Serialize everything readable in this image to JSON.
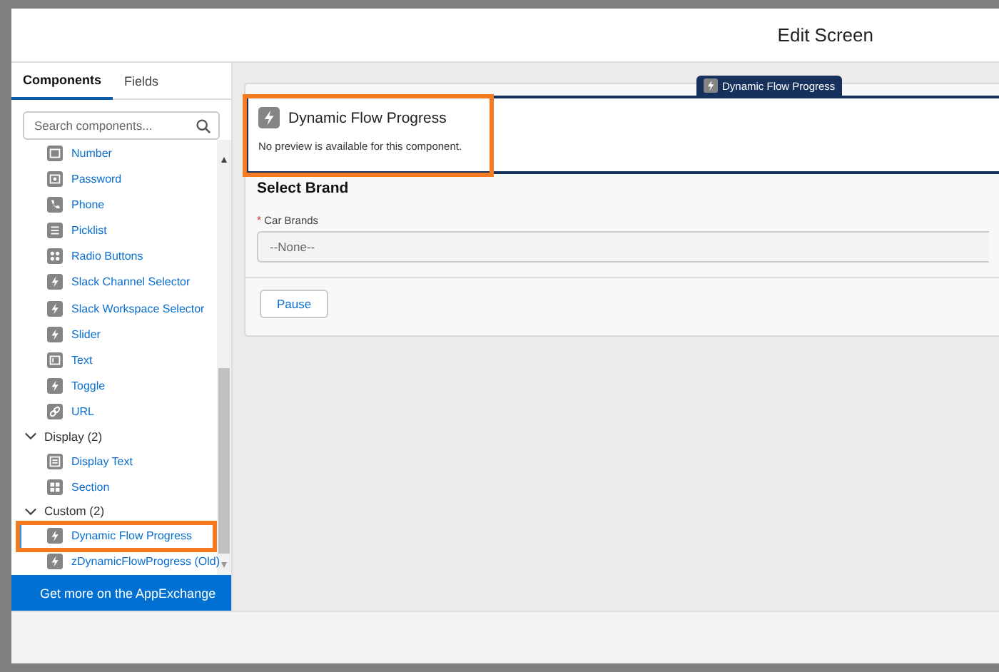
{
  "window": {
    "title": "Edit Screen"
  },
  "sidebar": {
    "tabs": [
      {
        "label": "Components",
        "selected": true
      },
      {
        "label": "Fields",
        "selected": false
      }
    ],
    "search": {
      "placeholder": "Search components..."
    },
    "items": [
      {
        "kind": "number",
        "label": "Number",
        "selected": false,
        "highlighted": false
      },
      {
        "kind": "password",
        "label": "Password",
        "selected": false,
        "highlighted": false
      },
      {
        "kind": "phone",
        "label": "Phone",
        "selected": false,
        "highlighted": false
      },
      {
        "kind": "picklist",
        "label": "Picklist",
        "selected": false,
        "highlighted": false
      },
      {
        "kind": "radio",
        "label": "Radio Buttons",
        "selected": false,
        "highlighted": false
      },
      {
        "kind": "lightning",
        "label": "Slack Channel Selector",
        "selected": false,
        "highlighted": false
      },
      {
        "kind": "lightning",
        "label": "Slack Workspace Selector",
        "selected": false,
        "highlighted": false
      },
      {
        "kind": "lightning",
        "label": "Slider",
        "selected": false,
        "highlighted": false
      },
      {
        "kind": "text",
        "label": "Text",
        "selected": false,
        "highlighted": false
      },
      {
        "kind": "lightning",
        "label": "Toggle",
        "selected": false,
        "highlighted": false
      },
      {
        "kind": "link",
        "label": "URL",
        "selected": false,
        "highlighted": false
      },
      {
        "kind": "group",
        "label": "Display (2)",
        "expanded": true,
        "children": [
          {
            "kind": "display_text",
            "label": "Display Text",
            "selected": false,
            "highlighted": false
          },
          {
            "kind": "section",
            "label": "Section",
            "selected": false,
            "highlighted": false
          }
        ]
      },
      {
        "kind": "group",
        "label": "Custom (2)",
        "expanded": true,
        "children": [
          {
            "kind": "lightning",
            "label": "Dynamic Flow Progress",
            "selected": true,
            "highlighted": true
          },
          {
            "kind": "lightning",
            "label": "zDynamicFlowProgress (Old)",
            "selected": false,
            "highlighted": false
          }
        ]
      }
    ],
    "footer_button": "Get more on the AppExchange"
  },
  "canvas": {
    "component_tab": "Dynamic Flow Progress",
    "preview": {
      "title": "Dynamic Flow Progress",
      "message": "No preview is available for this component.",
      "selected": true,
      "highlighted": true
    },
    "section_title": "Select Brand",
    "field": {
      "label": "Car Brands",
      "required_mark": "*",
      "value": "--None--"
    },
    "buttons": [
      "Pause"
    ]
  }
}
